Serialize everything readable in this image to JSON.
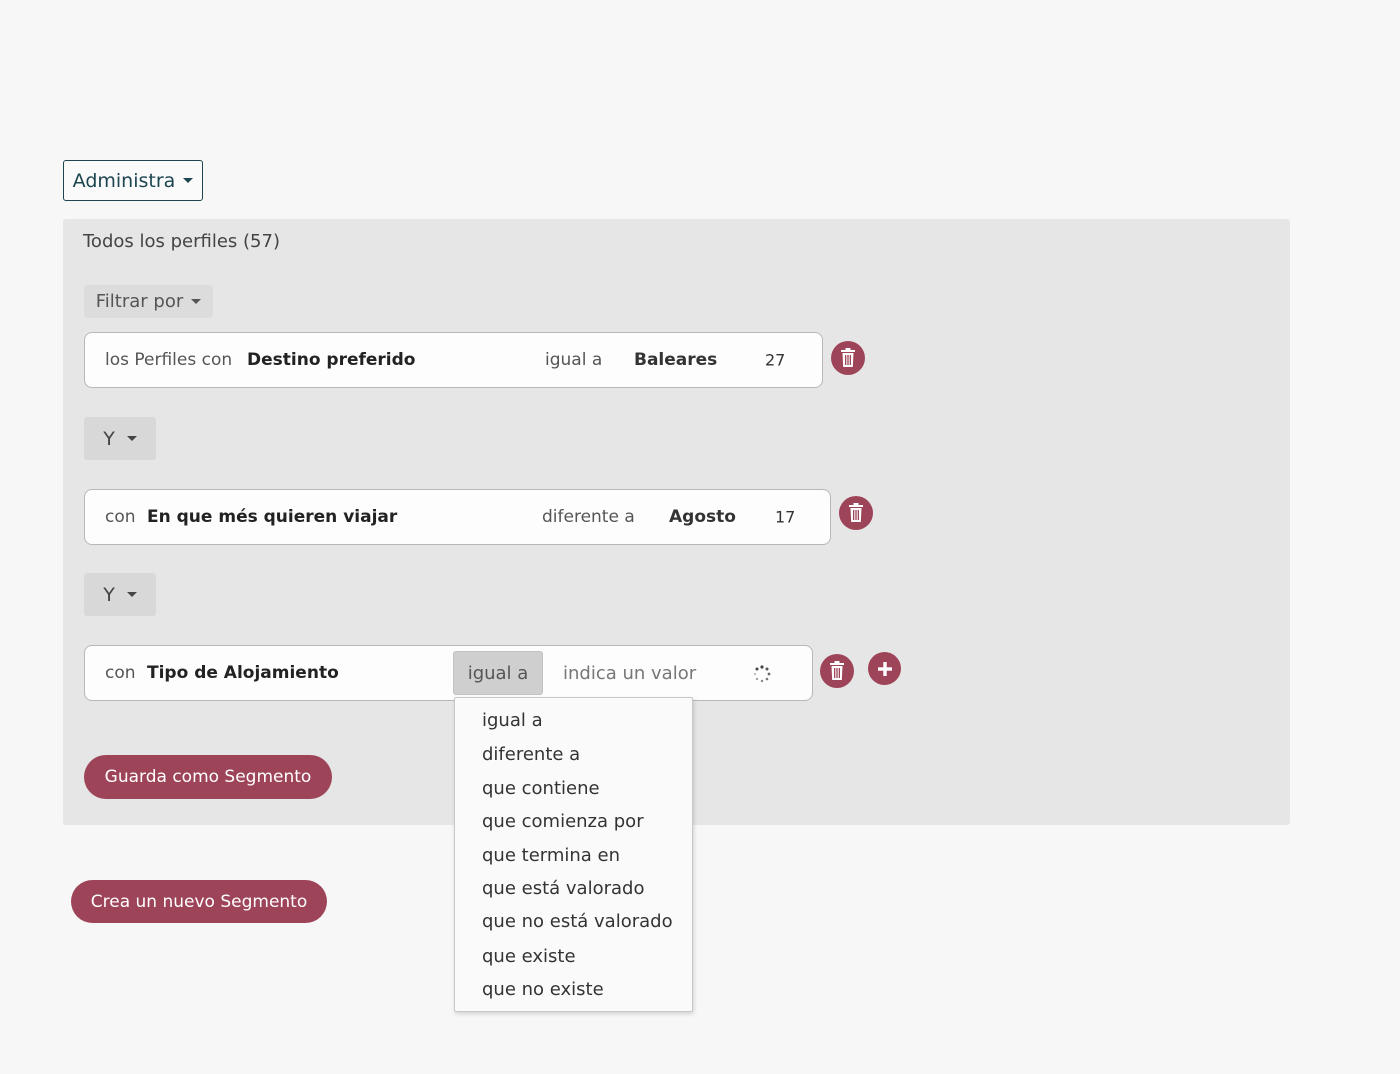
{
  "admin_menu": {
    "label": "Administra"
  },
  "panel": {
    "title": "Todos los perfiles (57)",
    "filter_label": "Filtrar por"
  },
  "rules": [
    {
      "prefix": "los Perfiles con",
      "field": "Destino preferido",
      "operator": "igual a",
      "value": "Baleares",
      "count": "27"
    },
    {
      "prefix": "con",
      "field": "En que més quieren viajar",
      "operator": "diferente a",
      "value": "Agosto",
      "count": "17"
    },
    {
      "prefix": "con",
      "field": "Tipo de Alojamiento",
      "operator": "igual a",
      "value_placeholder": "indica un valor"
    }
  ],
  "connectors": [
    "Y",
    "Y"
  ],
  "buttons": {
    "save_segment": "Guarda como Segmento",
    "new_segment": "Crea un nuevo Segmento"
  },
  "operator_dropdown": {
    "options": [
      "igual a",
      "diferente a",
      "que contiene",
      "que comienza por",
      "que termina en",
      "que está valorado",
      "que no está valorado",
      "que existe",
      "que no existe"
    ]
  },
  "colors": {
    "accent": "#9e4459",
    "admin_border": "#1c4550",
    "panel_bg": "#e6e6e6"
  },
  "icons": {
    "delete": "trash-icon",
    "add": "plus-icon",
    "loading": "spinner-icon",
    "caret": "caret-down-icon"
  }
}
